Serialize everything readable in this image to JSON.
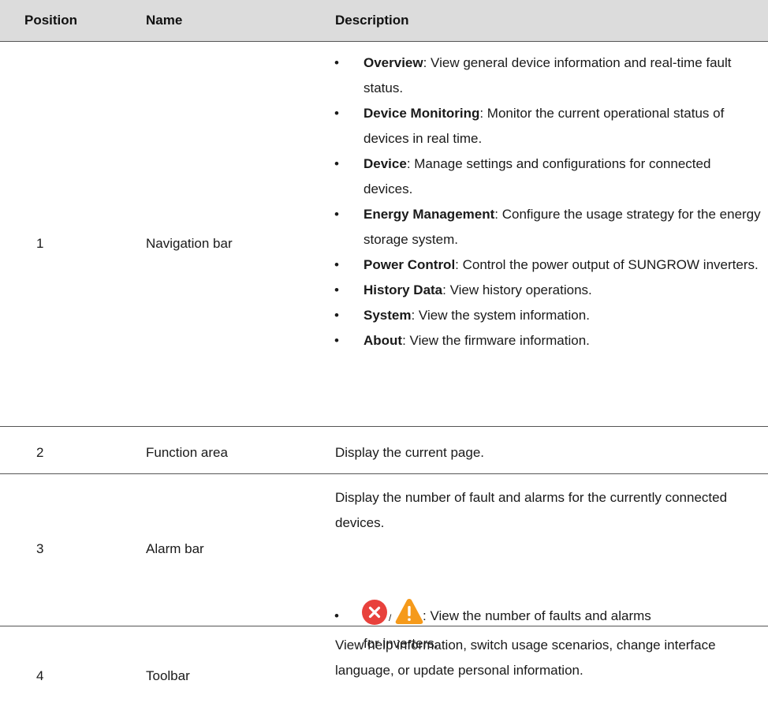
{
  "header": {
    "position": "Position",
    "name": "Name",
    "description": "Description"
  },
  "rows": [
    {
      "position": "1",
      "name": "Navigation bar",
      "bullets": [
        {
          "term": "Overview",
          "text": ": View general device information and real-time fault status."
        },
        {
          "term": "Device Monitoring",
          "text": ": Monitor the current operational status of devices in real time."
        },
        {
          "term": "Device",
          "text": ": Manage settings and configurations for connected devices."
        },
        {
          "term": "Energy Management",
          "text": ": Configure the usage strategy for the energy storage system."
        },
        {
          "term": "Power Control",
          "text": ": Control the power output of SUNGROW inverters."
        },
        {
          "term": "History Data",
          "text": ": View history operations."
        },
        {
          "term": "System",
          "text": ": View the system information."
        },
        {
          "term": "About",
          "text": ": View the firmware information."
        }
      ]
    },
    {
      "position": "2",
      "name": "Function area",
      "description": "Display the current page."
    },
    {
      "position": "3",
      "name": "Alarm bar",
      "description": "Display the number of fault and alarms for the currently connected devices.",
      "bullet_slash": "/",
      "bullet_text": ": View the number of faults and alarms",
      "bullet_text_cont": "for inverters.",
      "icons": [
        "fault-icon",
        "warning-icon"
      ],
      "colors": {
        "fault": "#e8413c",
        "warning": "#f59a1b"
      }
    },
    {
      "position": "4",
      "name": "Toolbar",
      "description": "View help information, switch usage scenarios, change interface language, or update personal information."
    }
  ],
  "bullet_char": "•"
}
